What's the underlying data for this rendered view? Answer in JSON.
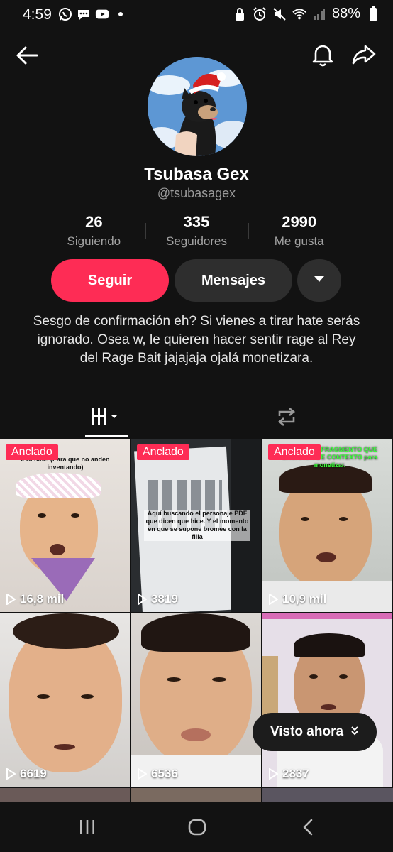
{
  "status_bar": {
    "time": "4:59",
    "battery": "88%",
    "left_icons": [
      "whatsapp-icon",
      "chat-icon",
      "youtube-icon",
      "dot-icon"
    ],
    "right_icons": [
      "lock-icon",
      "alarm-icon",
      "mute-icon",
      "wifi-icon",
      "signal-icon",
      "battery-icon"
    ]
  },
  "header": {
    "back_icon": "back-arrow-icon",
    "bell_icon": "bell-icon",
    "share_icon": "share-icon"
  },
  "profile": {
    "display_name": "Tsubasa Gex",
    "handle": "@tsubasagex"
  },
  "stats": [
    {
      "value": "26",
      "label": "Siguiendo"
    },
    {
      "value": "335",
      "label": "Seguidores"
    },
    {
      "value": "2990",
      "label": "Me gusta"
    }
  ],
  "actions": {
    "follow": "Seguir",
    "message": "Mensajes",
    "more_icon": "caret-down-icon"
  },
  "bio": "Sesgo de confirmación eh? Si vienes a tirar hate serás ignorado. Osea w, le quieren hacer sentir rage al Rey del Rage Bait jajajaja ojalá monetizara.",
  "tabs": {
    "videos_icon": "grid-icon",
    "reposts_icon": "repost-icon"
  },
  "videos": [
    {
      "pinned": "Anclado",
      "views": "16,8 mil",
      "caption": "e SI hice. (Para que no anden inventando)"
    },
    {
      "pinned": "Anclado",
      "views": "3819",
      "caption": "Aquí buscando el personaje PDF que dicen que hice. Y el momento en que se supone bromee con la filia"
    },
    {
      "pinned": "Anclado",
      "views": "10,9 mil",
      "caption": "ESTE ES EL FRAGMENTO QUE SACARON DE CONTEXTO para monetizar."
    },
    {
      "pinned": "",
      "views": "6619",
      "caption": ""
    },
    {
      "pinned": "",
      "views": "6536",
      "caption": ""
    },
    {
      "pinned": "",
      "views": "2837",
      "caption": ""
    }
  ],
  "seen_now": "Visto ahora",
  "colors": {
    "accent": "#fe2c55",
    "background": "#121212",
    "button_secondary": "#2e2e2e"
  },
  "nav": {
    "recents_icon": "recents-icon",
    "home_icon": "home-icon",
    "back_icon": "nav-back-icon"
  }
}
